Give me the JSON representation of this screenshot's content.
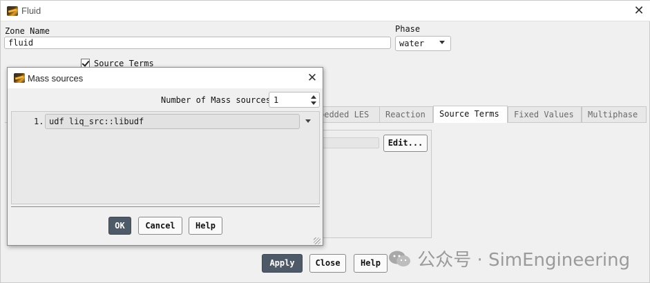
{
  "main_window": {
    "title": "Fluid",
    "zone_name_label": "Zone Name",
    "zone_name_value": "fluid",
    "phase_label": "Phase",
    "phase_value": "water",
    "source_terms_label": "Source Terms",
    "source_terms_checked": true,
    "tabs": [
      {
        "label": "bedded LES",
        "active": false
      },
      {
        "label": "Reaction",
        "active": false
      },
      {
        "label": "Source Terms",
        "active": true
      },
      {
        "label": "Fixed Values",
        "active": false
      },
      {
        "label": "Multiphase",
        "active": false
      }
    ],
    "edit_button": "Edit...",
    "buttons": {
      "apply": "Apply",
      "close": "Close",
      "help": "Help"
    }
  },
  "mass_dialog": {
    "title": "Mass sources",
    "count_label": "Number of Mass sources",
    "count_value": "1",
    "sources": [
      {
        "index": "1.",
        "value": "udf liq_src::libudf"
      }
    ],
    "buttons": {
      "ok": "OK",
      "cancel": "Cancel",
      "help": "Help"
    }
  },
  "watermark": {
    "text": "公众号 · SimEngineering"
  },
  "colors": {
    "window_bg": "#f0f0f0",
    "primary_button": "#4f5a68",
    "tab_inactive": "#e8e8e8"
  },
  "icons": [
    "fluent-app-icon",
    "close-icon",
    "chevron-down-icon",
    "spin-up-icon",
    "spin-down-icon",
    "resize-grip-icon",
    "wechat-icon"
  ]
}
